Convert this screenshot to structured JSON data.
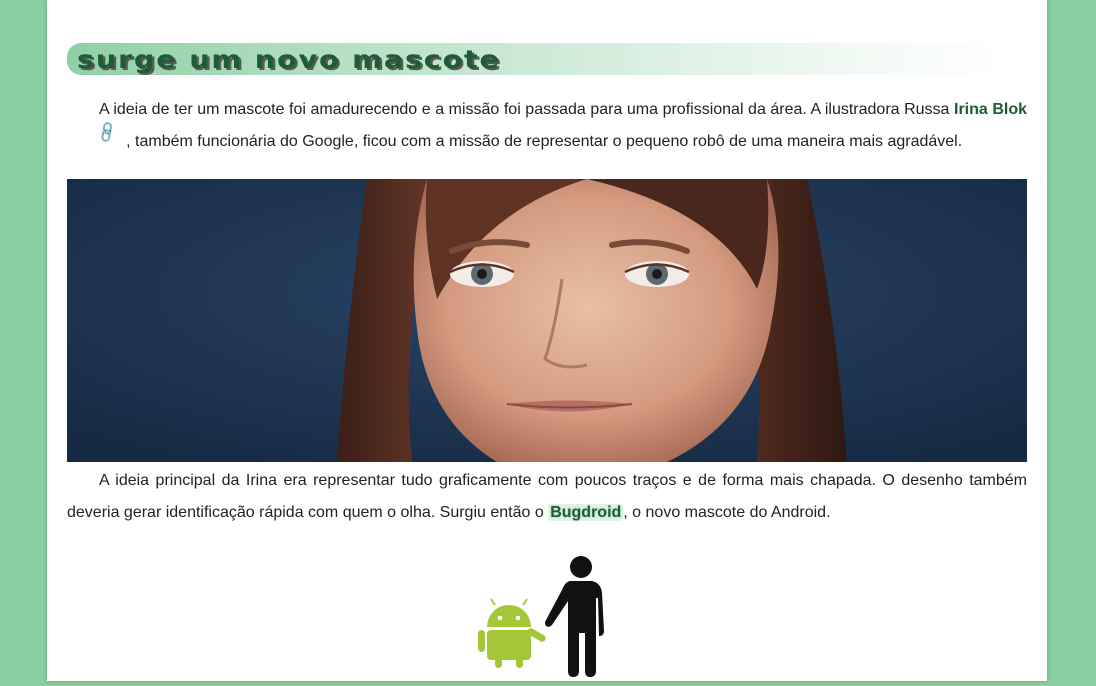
{
  "section": {
    "title": "Surge um novo mascote"
  },
  "paragraph1": {
    "text_before": "A ideia de ter um mascote foi amadurecendo e a missão foi passada para uma profissional da área. A ilustradora Russa ",
    "link_text": "Irina Blok",
    "link_icon": "link-icon",
    "text_after": " , também funcionária do Google, ficou com a missão de representar o pequeno robô de uma maneira mais agradável."
  },
  "photo": {
    "subject": "portrait-photo"
  },
  "paragraph2": {
    "text_before": "A ideia principal da Irina era representar tudo graficamente com poucos traços e de forma mais chapada. O desenho também deveria gerar identificação rápida com quem o olha. Surgiu então o ",
    "highlight": "Bugdroid",
    "text_after": ", o novo mascote do Android."
  },
  "colors": {
    "page_background": "#8acfa2",
    "accent_green": "#1e5c35",
    "android_green": "#a4c639"
  }
}
